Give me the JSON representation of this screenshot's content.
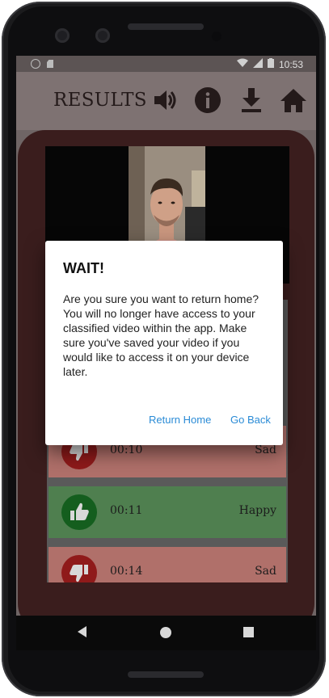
{
  "status_bar": {
    "time": "10:53"
  },
  "header": {
    "title": "RESULTS",
    "icons": [
      "speaker-icon",
      "info-icon",
      "download-icon",
      "home-icon"
    ]
  },
  "results": [
    {
      "time": "00:10",
      "emotion": "Sad",
      "icon": "thumbs-down-icon"
    },
    {
      "time": "00:11",
      "emotion": "Happy",
      "icon": "thumbs-up-icon"
    },
    {
      "time": "00:14",
      "emotion": "Sad",
      "icon": "thumbs-down-icon"
    }
  ],
  "dialog": {
    "title": "WAIT!",
    "message": "Are you sure you want to return home? You will no longer have access to your classified video within the app. Make sure you've saved your video if you would like to access it on your device later.",
    "return_home_label": "Return Home",
    "go_back_label": "Go Back"
  },
  "colors": {
    "accent_link": "#2a8bd6",
    "sad_row": "#b0706a",
    "happy_row": "#4f7f4f",
    "card_background": "#3a1d1d"
  }
}
